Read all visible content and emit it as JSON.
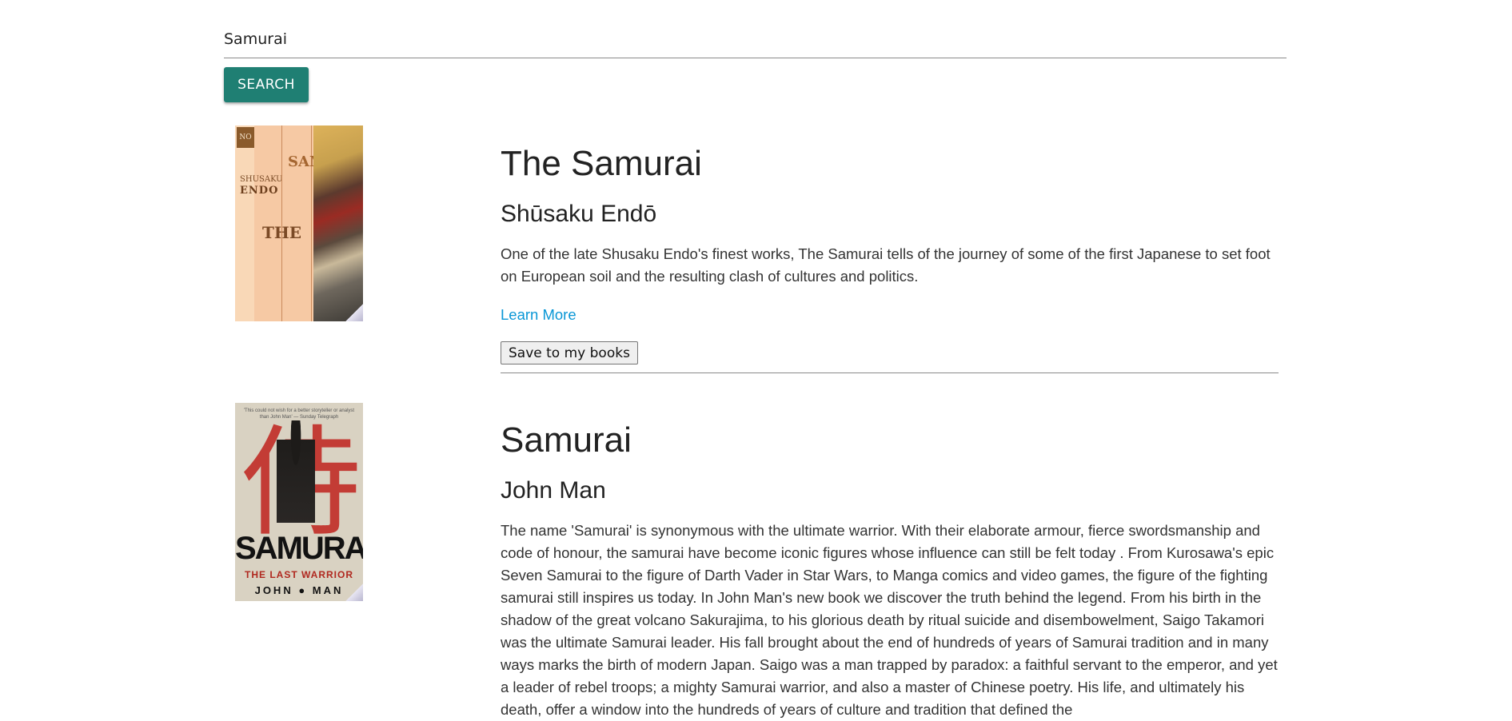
{
  "search": {
    "value": "Samurai",
    "button_label": "SEARCH"
  },
  "results": [
    {
      "cover": {
        "publisher_mark": "NO",
        "author_first": "SHUSAKU",
        "author_last": "ENDO",
        "title_letters_left": "THE",
        "title_letters_right": "SAMURAI"
      },
      "title": "The Samurai",
      "author": "Shūsaku Endō",
      "description": "One of the late Shusaku Endo's finest works, The Samurai tells of the journey of some of the first Japanese to set foot on European soil and the resulting clash of cultures and politics.",
      "learn_more_label": "Learn More",
      "save_label": "Save to my books"
    },
    {
      "cover": {
        "blurb": "'This could not wish for a better storyteller or analyst than John Man' — Sunday Telegraph",
        "glyph": "侍",
        "title": "SAMURAI",
        "subtitle": "THE LAST WARRIOR",
        "author": "JOHN ● MAN"
      },
      "title": "Samurai",
      "author": "John Man",
      "description": "The name 'Samurai' is synonymous with the ultimate warrior. With their elaborate armour, fierce swordsmanship and code of honour, the samurai have become iconic figures whose influence can still be felt today . From Kurosawa's epic Seven Samurai to the figure of Darth Vader in Star Wars, to Manga comics and video games, the figure of the fighting samurai still inspires us today. In John Man's new book we discover the truth behind the legend. From his birth in the shadow of the great volcano Sakurajima, to his glorious death by ritual suicide and disembowelment, Saigo Takamori was the ultimate Samurai leader. His fall brought about the end of hundreds of years of Samurai tradition and in many ways marks the birth of modern Japan. Saigo was a man trapped by paradox: a faithful servant to the emperor, and yet a leader of rebel troops; a mighty Samurai warrior, and also a master of Chinese poetry. His life, and ultimately his death, offer a window into the hundreds of years of culture and tradition that defined the"
    }
  ],
  "colors": {
    "search_button": "#1f7f73",
    "link": "#0a97d6",
    "divider": "#8a8a8a"
  }
}
